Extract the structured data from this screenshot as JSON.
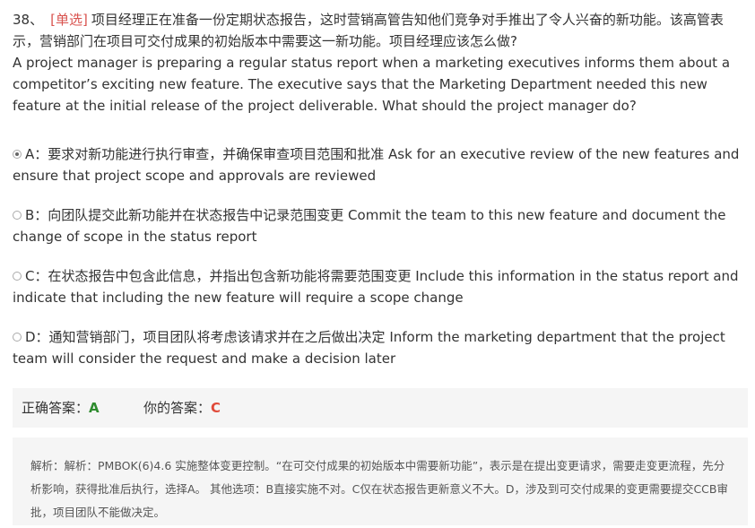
{
  "question": {
    "number": "38、",
    "type": "[单选]",
    "text_zh": "项目经理正在准备一份定期状态报告，这时营销高管告知他们竞争对手推出了令人兴奋的新功能。该高管表示，营销部门在项目可交付成果的初始版本中需要这一新功能。项目经理应该怎么做?",
    "text_en": "A project manager is preparing a regular status report when a marketing executives informs them about a competitor’s exciting new feature. The executive says that the Marketing Department needed this new feature at the initial release of the project deliverable. What should the project manager do?"
  },
  "options": [
    {
      "text": "A：要求对新功能进行执行审查，并确保审查项目范围和批准 Ask for an executive review of the new features and ensure that project scope and approvals are reviewed",
      "selected": true
    },
    {
      "text": "B：向团队提交此新功能并在状态报告中记录范围变更 Commit the team to this new feature and document the change of scope in the status report",
      "selected": false
    },
    {
      "text": "C：在状态报告中包含此信息，并指出包含新功能将需要范围变更 Include this information in the status report and indicate that including the new feature will require a scope change",
      "selected": false
    },
    {
      "text": "D：通知营销部门，项目团队将考虑该请求并在之后做出决定 Inform the marketing department that the project team will consider the request and make a decision later",
      "selected": false
    }
  ],
  "answer": {
    "correct_label": "正确答案：",
    "correct_value": "A",
    "your_label": "你的答案：",
    "your_value": "C"
  },
  "analysis": {
    "text": "解析：解析：PMBOK(6)4.6 实施整体变更控制。“在可交付成果的初始版本中需要新功能”，表示是在提出变更请求，需要走变更流程，先分析影响，获得批准后执行，选择A。 其他选项：B直接实施不对。C仅在状态报告更新意义不大。D，涉及到可交付成果的变更需要提交CCB审批，项目团队不能做决定。"
  },
  "colors": {
    "question_type": "#d9534f",
    "correct": "#2e8b2e",
    "wrong": "#e04a3a",
    "panel_bg": "#f5f5f5"
  },
  "icons": {
    "option_selector": "radio-icon"
  }
}
